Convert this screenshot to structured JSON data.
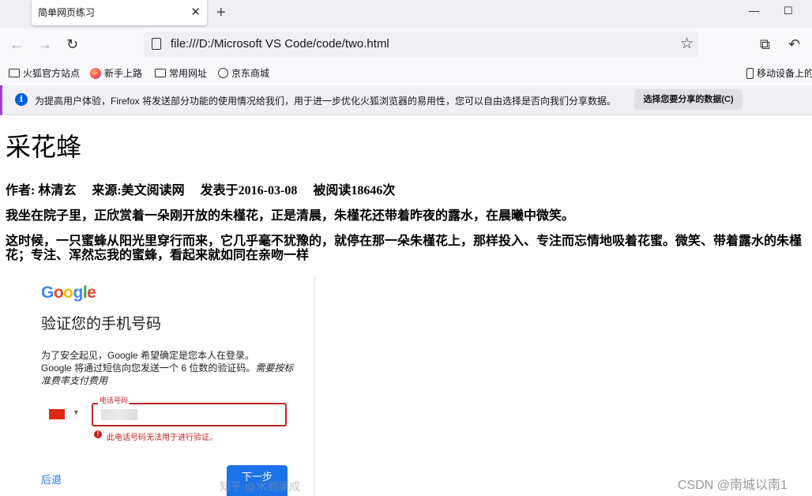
{
  "browser": {
    "tab_title": "简单网页练习",
    "tab_close": "✕",
    "new_tab": "+",
    "window_min": "—",
    "window_max": "☐",
    "url": "file:///D:/Microsoft VS Code/code/two.html",
    "bookmarks": [
      "火狐官方站点",
      "新手上路",
      "常用网址",
      "京东商城"
    ],
    "mobile_bookmarks": "移动设备上的",
    "notice_text": "为提高用户体验，Firefox 将发送部分功能的使用情况给我们，用于进一步优化火狐浏览器的易用性，您可以自由选择是否向我们分享数据。",
    "notice_button": "选择您要分享的数据(C)"
  },
  "page": {
    "title": "采花蜂",
    "meta": "作者: 林清玄     来源:美文阅读网     发表于2016-03-08     被阅读18646次",
    "paragraph1": "我坐在院子里，正欣赏着一朵刚开放的朱槿花，正是清晨，朱槿花还带着昨夜的露水，在晨曦中微笑。",
    "paragraph2": "这时候，一只蜜蜂从阳光里穿行而来，它几乎毫不犹豫的，就停在那一朵朱槿花上，那样投入、专注而忘情地吸着花蜜。微笑、带着露水的朱槿花；专注、浑然忘我的蜜蜂，看起来就如同在亲吻一样"
  },
  "embedded": {
    "logo": "Google",
    "heading": "验证您的手机号码",
    "desc_line1": "为了安全起见，Google 希望确定是您本人在登录。",
    "desc_line2": "Google 将通过短信向您发送一个 6 位数的验证码。",
    "desc_italic": "需要按标准费率支付费用",
    "phone_label": "电话号码",
    "error_text": "此电话号码无法用于进行验证。",
    "back_label": "后退",
    "next_label": "下一步"
  },
  "watermarks": {
    "zhihu": "知乎 @水到渠成",
    "csdn": "CSDN @南城以南1"
  },
  "colors": {
    "google_blue": "#1a73e8",
    "error_red": "#c5221f",
    "notice_accent": "#a33dd5"
  }
}
